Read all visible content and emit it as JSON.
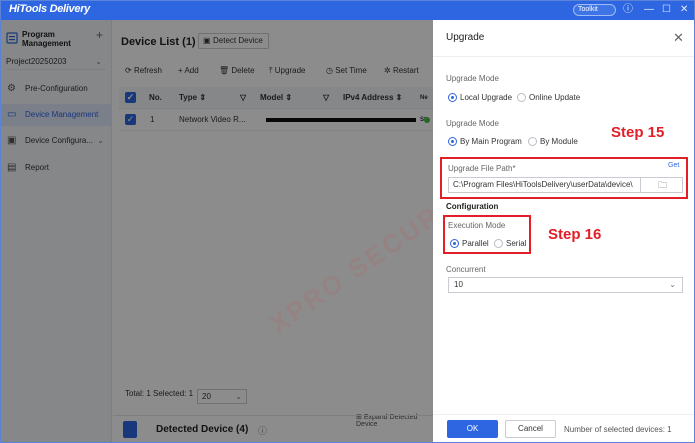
{
  "app": {
    "title": "HiTools Delivery",
    "toolkit_label": "Toolkit",
    "help_icon": "question-circle-icon",
    "min_icon": "minimize-icon",
    "max_icon": "maximize-icon",
    "close_icon": "close-icon"
  },
  "sidebar": {
    "title": "Program Management",
    "add_icon": "plus-icon",
    "project": "Project20250203",
    "items": [
      {
        "label": "Pre-Configuration",
        "icon": "gear-icon"
      },
      {
        "label": "Device Management",
        "icon": "device-icon",
        "active": true
      },
      {
        "label": "Device Configura...",
        "icon": "config-icon"
      },
      {
        "label": "Report",
        "icon": "report-icon"
      }
    ]
  },
  "main": {
    "title": "Device List",
    "count": "(1)",
    "detect_label": "Detect Device",
    "toolbar": [
      "Refresh",
      "Add",
      "Delete",
      "Upgrade",
      "Set Time",
      "Restart"
    ],
    "columns": [
      "No.",
      "Type",
      "Model",
      "IPv4 Address",
      "Ne Sta"
    ],
    "rows": [
      {
        "no": "1",
        "type": "Network Video R..."
      }
    ],
    "total_text": "Total: 1  Selected: 1",
    "page_size": "20",
    "expand_label": "Expand Detected Device",
    "detected_label": "Detected Device",
    "detected_count": "(4)"
  },
  "panel": {
    "title": "Upgrade",
    "upgrade_mode_label": "Upgrade Mode",
    "upgrade_mode_options": [
      "Local Upgrade",
      "Online Update"
    ],
    "upgrade_mode_selected": "Local Upgrade",
    "upgrade_mode2_label": "Upgrade Mode",
    "upgrade_mode2_options": [
      "By Main Program",
      "By Module"
    ],
    "upgrade_mode2_selected": "By Main Program",
    "file_path_label": "Upgrade File Path*",
    "get_link": "Get",
    "file_path_value": "C:\\Program Files\\HiToolsDelivery\\userData\\device\\",
    "configuration_label": "Configuration",
    "exec_mode_label": "Execution Mode",
    "exec_mode_options": [
      "Parallel",
      "Serial"
    ],
    "exec_mode_selected": "Parallel",
    "concurrent_label": "Concurrent",
    "concurrent_value": "10",
    "ok_label": "OK",
    "cancel_label": "Cancel",
    "selected_devices_text": "Number of selected devices: 1"
  },
  "annotations": {
    "step15": "Step 15",
    "step16": "Step 16",
    "color": "#e21e26"
  },
  "watermark": "XPRO SECURITY",
  "colors": {
    "accent": "#2d66e0",
    "titlebar": "#2d66e0",
    "online": "#3fbf4c"
  }
}
